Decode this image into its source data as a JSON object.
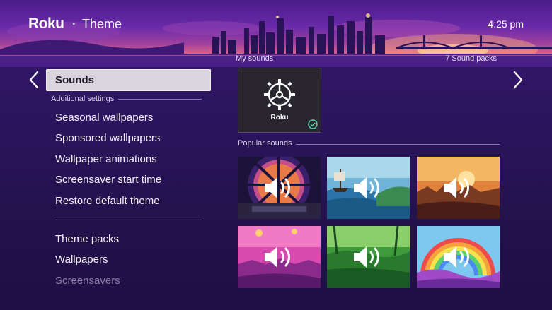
{
  "header": {
    "logo": "Roku",
    "separator": "•",
    "title": "Theme",
    "time": "4:25 pm"
  },
  "menu": {
    "selected": "Sounds",
    "subheading": "Additional settings",
    "items": [
      {
        "label": "Seasonal wallpapers"
      },
      {
        "label": "Sponsored wallpapers"
      },
      {
        "label": "Wallpaper animations"
      },
      {
        "label": "Screensaver start time"
      },
      {
        "label": "Restore default theme"
      }
    ],
    "items_lower": [
      {
        "label": "Theme packs"
      },
      {
        "label": "Wallpapers"
      },
      {
        "label": "Screensavers"
      }
    ]
  },
  "my_sounds": {
    "label": "My sounds",
    "count": "7 Sound packs",
    "tile_brand": "Roku"
  },
  "popular": {
    "label": "Popular sounds",
    "tiles": [
      {
        "icon": "speaker-icon",
        "theme": "spaceship-cockpit"
      },
      {
        "icon": "speaker-icon",
        "theme": "pirate-ship-island"
      },
      {
        "icon": "speaker-icon",
        "theme": "desert-sunset-city"
      },
      {
        "icon": "speaker-icon",
        "theme": "magic-kingdom"
      },
      {
        "icon": "speaker-icon",
        "theme": "jungle"
      },
      {
        "icon": "speaker-icon",
        "theme": "rainbow-land"
      }
    ]
  },
  "colors": {
    "accent_check": "#4fd1a0",
    "selected_bg": "#d8d5dc"
  }
}
